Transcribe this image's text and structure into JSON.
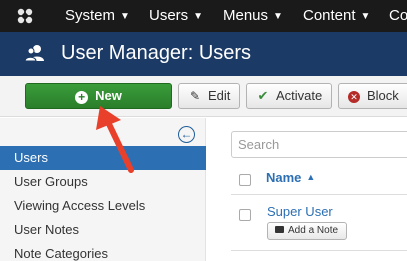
{
  "navbar": {
    "items": [
      {
        "label": "System"
      },
      {
        "label": "Users"
      },
      {
        "label": "Menus"
      },
      {
        "label": "Content"
      },
      {
        "label": "Co"
      }
    ]
  },
  "subhead": {
    "title": "User Manager: Users"
  },
  "toolbar": {
    "new_label": "New",
    "edit_label": "Edit",
    "activate_label": "Activate",
    "block_label": "Block"
  },
  "sidebar": {
    "items": [
      {
        "label": "Users",
        "active": true
      },
      {
        "label": "User Groups"
      },
      {
        "label": "Viewing Access Levels"
      },
      {
        "label": "User Notes"
      },
      {
        "label": "Note Categories"
      }
    ]
  },
  "main": {
    "search_placeholder": "Search",
    "column_name": "Name",
    "rows": [
      {
        "name": "Super User",
        "note_button": "Add a Note"
      }
    ]
  },
  "colors": {
    "navbar": "#1a1a1a",
    "subhead": "#1b3a66",
    "new_button": "#2f8f2f",
    "active_item": "#2c6fb3",
    "arrow": "#e8402a"
  }
}
